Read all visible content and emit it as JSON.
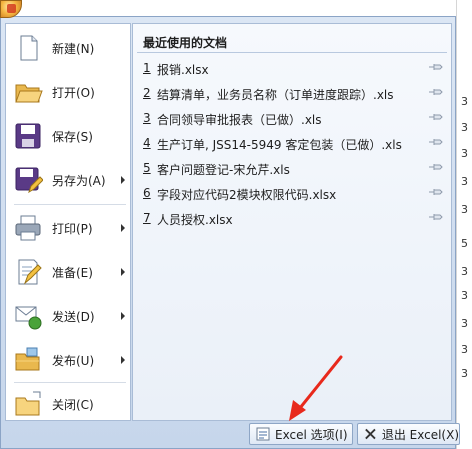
{
  "background_sheet": {
    "cells": [
      "3",
      "3",
      "3",
      "3",
      "3",
      "5",
      "3",
      "3",
      "3",
      "3",
      "3"
    ]
  },
  "left_menu": {
    "items": [
      {
        "label": "新建(N)",
        "has_submenu": false
      },
      {
        "label": "打开(O)",
        "has_submenu": false
      },
      {
        "label": "保存(S)",
        "has_submenu": false
      },
      {
        "label": "另存为(A)",
        "has_submenu": true
      },
      {
        "label": "打印(P)",
        "has_submenu": true
      },
      {
        "label": "准备(E)",
        "has_submenu": true
      },
      {
        "label": "发送(D)",
        "has_submenu": true
      },
      {
        "label": "发布(U)",
        "has_submenu": true
      },
      {
        "label": "关闭(C)",
        "has_submenu": false
      }
    ]
  },
  "recent": {
    "title": "最近使用的文档",
    "documents": [
      {
        "num": "1",
        "name": "报销.xlsx"
      },
      {
        "num": "2",
        "name": "结算清单，业务员名称（订单进度跟踪）.xls"
      },
      {
        "num": "3",
        "name": "合同领导审批报表（已做）.xls"
      },
      {
        "num": "4",
        "name": "生产订单, JSS14-5949 客定包装（已做）.xls"
      },
      {
        "num": "5",
        "name": "客户问题登记-宋允芹.xls"
      },
      {
        "num": "6",
        "name": "字段对应代码2模块权限代码.xlsx"
      },
      {
        "num": "7",
        "name": "人员授权.xlsx"
      }
    ]
  },
  "bottom": {
    "options_label": "Excel 选项(I)",
    "exit_label": "退出 Excel(X)"
  },
  "colors": {
    "frame": "#c6d6eb",
    "annotation_arrow": "#e8291c"
  }
}
